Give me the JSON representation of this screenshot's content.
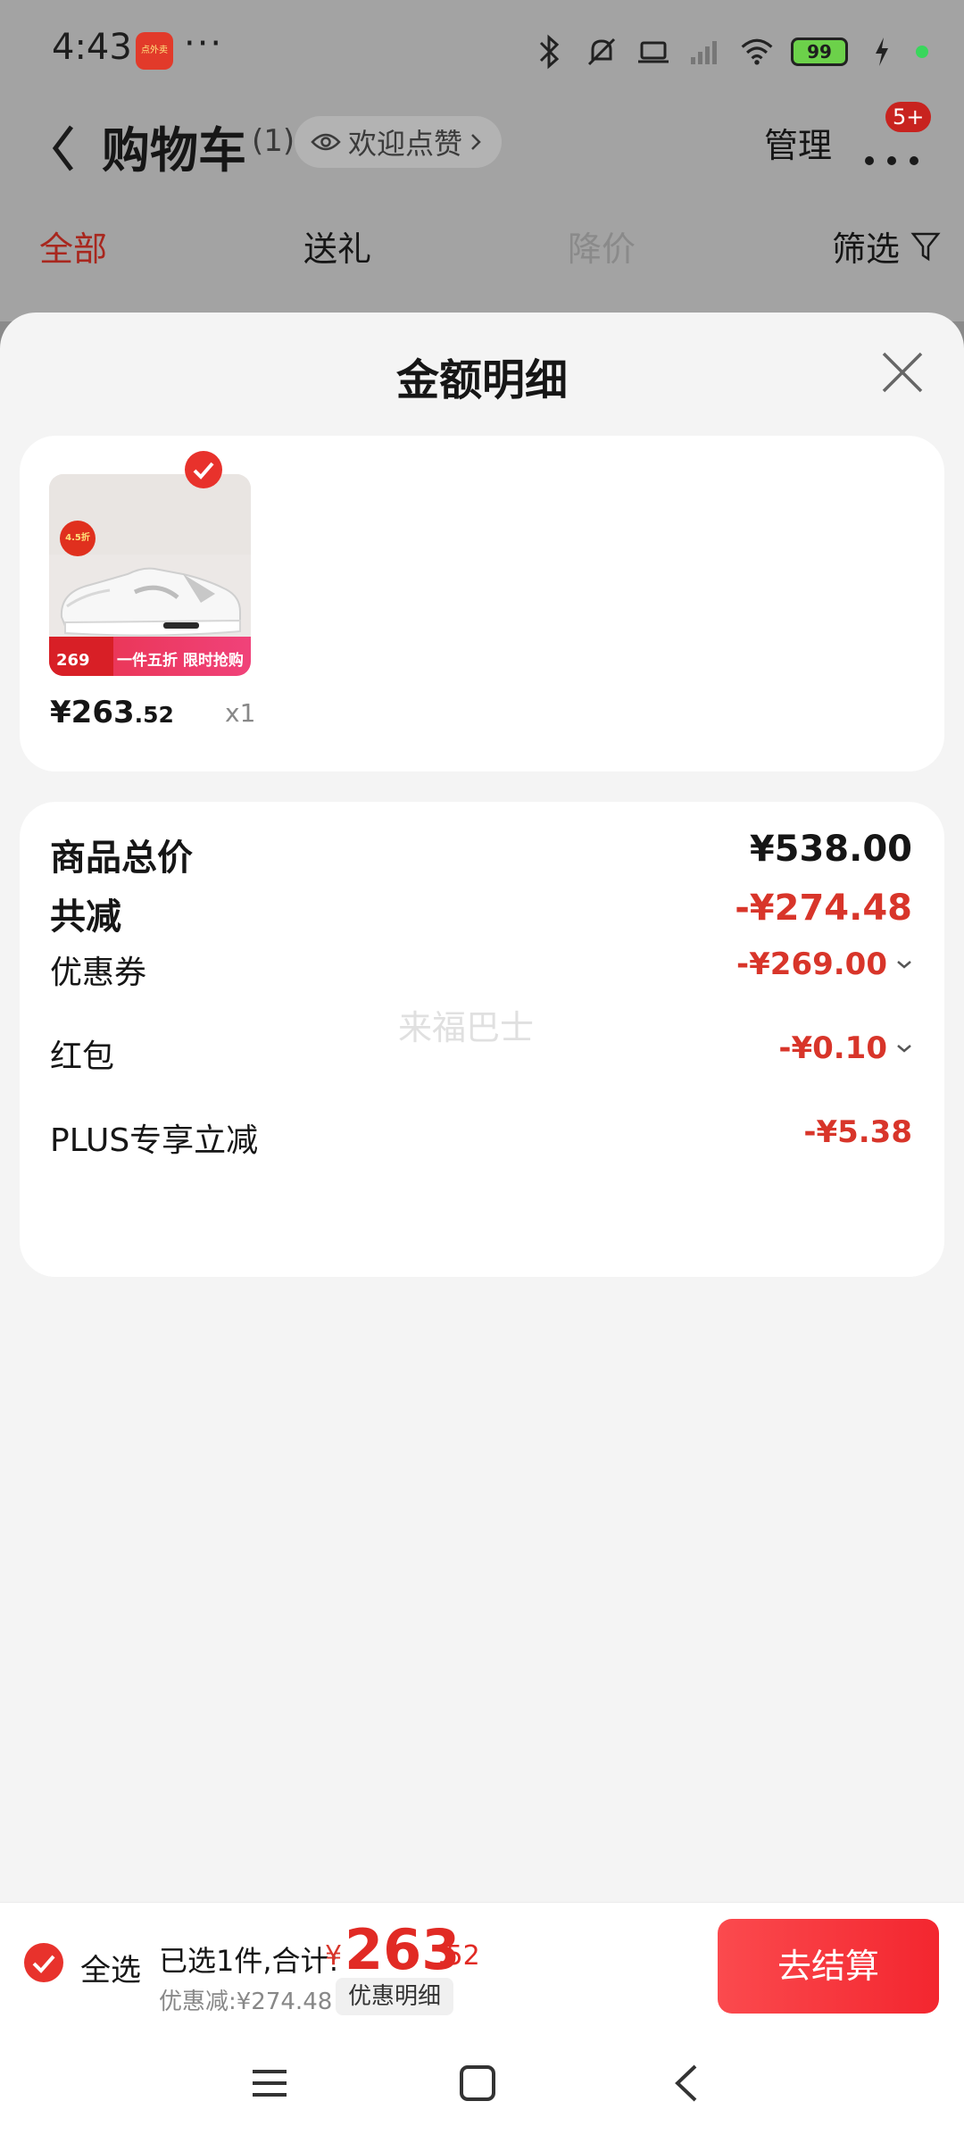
{
  "status_bar": {
    "time": "4:43",
    "dots": "···",
    "battery": "99",
    "app_icon_label": "点外卖"
  },
  "nav": {
    "title": "购物车",
    "count": "(1)",
    "like_label": "欢迎点赞",
    "manage_label": "管理",
    "badge": "5+"
  },
  "tabs": [
    {
      "label": "全部"
    },
    {
      "label": "送礼"
    },
    {
      "label": "降价"
    },
    {
      "label": "筛选"
    }
  ],
  "sheet": {
    "title": "金额明细",
    "item": {
      "price_main": "¥263",
      "price_cents": ".52",
      "qty": "x1",
      "thumb_badge": "4.5折",
      "thumb_price": "269",
      "thumb_promo": "一件五折 限时抢购"
    },
    "summary": {
      "total_label": "商品总价",
      "total_value": "¥538.00",
      "reduce_label": "共减",
      "reduce_value": "-¥274.48",
      "coupon_label": "优惠券",
      "coupon_value": "-¥269.00",
      "redpacket_label": "红包",
      "redpacket_value": "-¥0.10",
      "plus_label": "PLUS专享立减",
      "plus_value": "-¥5.38"
    },
    "watermark": "来福巴士"
  },
  "bottom_bar": {
    "select_all_label": "全选",
    "summary_text": "已选1件,合计:",
    "total_sym": "¥",
    "total_main": "263",
    "total_cents": ".52",
    "discount_text": "优惠减:¥274.48",
    "detail_label": "优惠明细",
    "checkout_label": "去结算"
  },
  "colors": {
    "accent_red": "#e12a24",
    "checkout_red": "#f3262f",
    "overlay_gray": "#a3a3a3"
  }
}
